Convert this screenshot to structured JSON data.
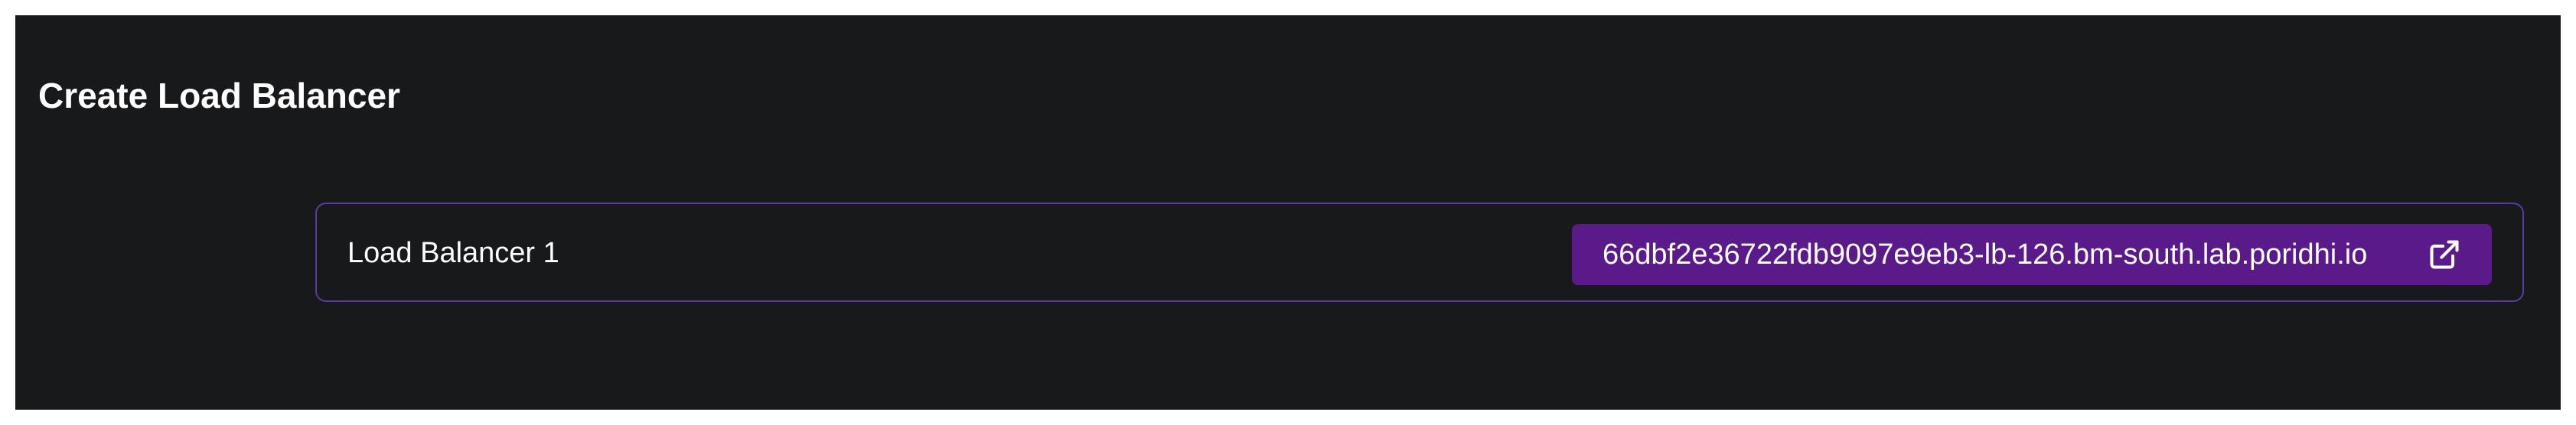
{
  "header": {
    "title": "Create Load Balancer"
  },
  "load_balancers": [
    {
      "label": "Load Balancer 1",
      "url": "66dbf2e36722fdb9097e9eb3-lb-126.bm-south.lab.poridhi.io",
      "icon": "external-link-icon"
    }
  ],
  "colors": {
    "panel_background": "#18191b",
    "border_accent": "#5d3aa3",
    "link_background": "#5b1a8a",
    "text": "#ffffff"
  }
}
